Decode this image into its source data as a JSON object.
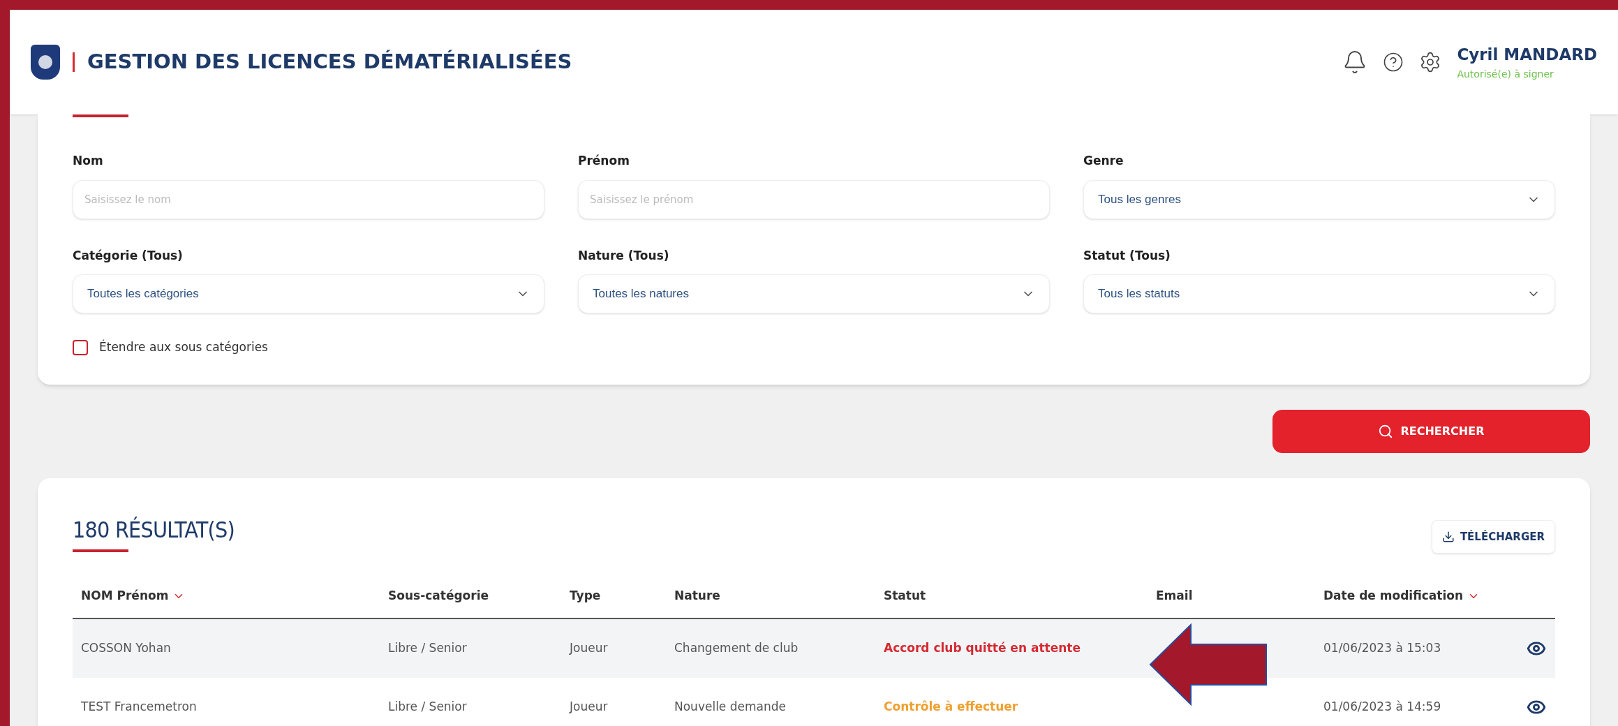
{
  "header": {
    "title": "GESTION DES LICENCES DÉMATÉRIALISÉES",
    "user_name": "Cyril MANDARD",
    "user_role": "Autorisé(e) à signer"
  },
  "filters": {
    "fields": [
      {
        "kind": "text",
        "label": "Nom",
        "placeholder": "Saisissez le nom"
      },
      {
        "kind": "text",
        "label": "Prénom",
        "placeholder": "Saisissez le prénom"
      },
      {
        "kind": "select",
        "label": "Genre",
        "value": "Tous les genres"
      },
      {
        "kind": "select",
        "label": "Catégorie (Tous)",
        "value": "Toutes les catégories"
      },
      {
        "kind": "select",
        "label": "Nature (Tous)",
        "value": "Toutes les natures"
      },
      {
        "kind": "select",
        "label": "Statut (Tous)",
        "value": "Tous les statuts"
      }
    ],
    "checkbox": {
      "label": "Étendre aux sous catégories",
      "checked": false
    }
  },
  "search_button": "RECHERCHER",
  "results": {
    "title": "180 RÉSULTAT(S)",
    "download_button": "TÉLÉCHARGER",
    "columns": [
      {
        "label": "NOM Prénom",
        "sortable": true
      },
      {
        "label": "Sous-catégorie",
        "sortable": false
      },
      {
        "label": "Type",
        "sortable": false
      },
      {
        "label": "Nature",
        "sortable": false
      },
      {
        "label": "Statut",
        "sortable": false
      },
      {
        "label": "Email",
        "sortable": false
      },
      {
        "label": "Date de modification",
        "sortable": true
      }
    ],
    "rows": [
      {
        "name": "COSSON Yohan",
        "subcategory": "Libre / Senior",
        "type": "Joueur",
        "nature": "Changement de club",
        "status": "Accord club quitté en attente",
        "color": "#d62a32",
        "date": "01/06/2023 à 15:03"
      },
      {
        "name": "TEST Francemetron",
        "subcategory": "Libre / Senior",
        "type": "Joueur",
        "nature": "Nouvelle demande",
        "status": "Contrôle à effectuer",
        "color": "#f0a030",
        "date": "01/06/2023 à 14:59"
      }
    ]
  }
}
